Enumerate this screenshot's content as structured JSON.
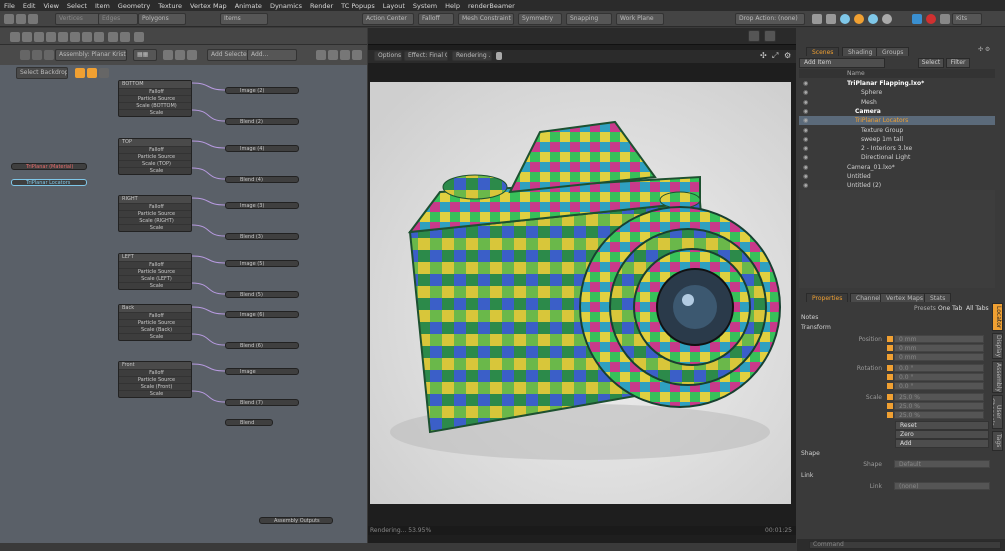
{
  "menu": [
    "File",
    "Edit",
    "View",
    "Select",
    "Item",
    "Geometry",
    "Texture",
    "Vertex Map",
    "Animate",
    "Dynamics",
    "Render",
    "TC Popups",
    "Layout",
    "System",
    "Help",
    "renderBeamer"
  ],
  "toolbar": {
    "vertices": "Vertices",
    "edges": "Edges",
    "polygons": "Polygons",
    "items": "Items",
    "action_center": "Action Center",
    "falloff": "Falloff",
    "snap": "Snapping",
    "symmetry": "Symmetry",
    "mesh_constraint": "Mesh Constraint",
    "work_plane": "Work Plane",
    "drop_action": "Drop Action: (none)",
    "kits": "Kits"
  },
  "schematic": {
    "assembly": "Assembly: Planar Kristir",
    "add_selected": "Add Selected",
    "add_menu": "Add...",
    "select_backdrop": "Select Backdrop",
    "node_groups": [
      {
        "name": "BOTTOM",
        "scale": "Scale (BOTTOM)"
      },
      {
        "name": "TOP",
        "scale": "Scale (TOP)"
      },
      {
        "name": "RIGHT",
        "scale": "Scale (RIGHT)"
      },
      {
        "name": "LEFT",
        "scale": "Scale (LEFT)"
      },
      {
        "name": "Back",
        "scale": "Scale (Back)"
      },
      {
        "name": "Front",
        "scale": "Scale (Front)"
      }
    ],
    "node_rows": {
      "falloff": "Falloff",
      "particle": "Particle Source",
      "scale": "Scale"
    },
    "image_nodes": [
      "Image (2)",
      "Image (4)",
      "Image (3)",
      "Image (5)",
      "Image (6)",
      "Image"
    ],
    "blend_nodes": [
      "Blend (2)",
      "Blend (4)",
      "Blend (3)",
      "Blend (5)",
      "Blend (6)",
      "Blend (7)"
    ],
    "blend_last": "Blend",
    "tri_material": "TriPlanar (Material)",
    "tri_locators": "TriPlanar Locators",
    "assembly_outputs": "Assembly Outputs"
  },
  "viewport": {
    "options": "Options",
    "effect": "Effect: Final C...",
    "rendering_btn": "Rendering ...",
    "status": "Rendering... 53.95%",
    "time": "00:01:25"
  },
  "scene_tabs": [
    "Scenes",
    "Shading",
    "Groups"
  ],
  "outliner": {
    "add_item": "Add Item",
    "select": "Select",
    "filter": "Filter",
    "col_name": "Name",
    "rows": [
      {
        "label": "TriPlanar Flapping.lxo*",
        "bold": true
      },
      {
        "label": "Sphere",
        "bold": false
      },
      {
        "label": "Mesh",
        "bold": false
      },
      {
        "label": "Camera",
        "bold": true
      },
      {
        "label": "TriPlanar Locators",
        "bold": false,
        "sel": true
      },
      {
        "label": "Texture Group",
        "bold": false
      },
      {
        "label": "sweep 1m tall",
        "bold": false
      },
      {
        "label": "2 - Interiors 3.lxe",
        "bold": false
      },
      {
        "label": "Directional Light",
        "bold": false
      },
      {
        "label": "Camera_01.lxo*",
        "bold": false
      },
      {
        "label": "Untitled",
        "bold": false
      },
      {
        "label": "Untitled (2)",
        "bold": false
      }
    ]
  },
  "prop_tabs": [
    "Properties",
    "Channels",
    "Vertex Maps",
    "Stats"
  ],
  "properties": {
    "presets": "Presets",
    "one_tab": "One Tab",
    "all_tabs": "All Tabs",
    "notes": "Notes",
    "transform": "Transform",
    "position_label": "Position",
    "rotation_label": "Rotation",
    "scale_label": "Scale",
    "position": [
      "0 mm",
      "0 mm",
      "0 mm"
    ],
    "rotation": [
      "0.0 °",
      "0.0 °",
      "0.0 °"
    ],
    "scale": [
      "25.0 %",
      "25.0 %",
      "25.0 %"
    ],
    "reset": "Reset",
    "zero": "Zero",
    "add": "Add",
    "shape": "Shape",
    "shape_label": "Shape",
    "shape_value": "Default",
    "link": "Link",
    "link_label": "Link",
    "link_value": "(none)"
  },
  "side_tabs": [
    "Locator",
    "Display",
    "Assembly",
    "User Channels",
    "Tags"
  ],
  "command": "Command",
  "accent": "#f0a032",
  "select_color": "#7fc7e8"
}
